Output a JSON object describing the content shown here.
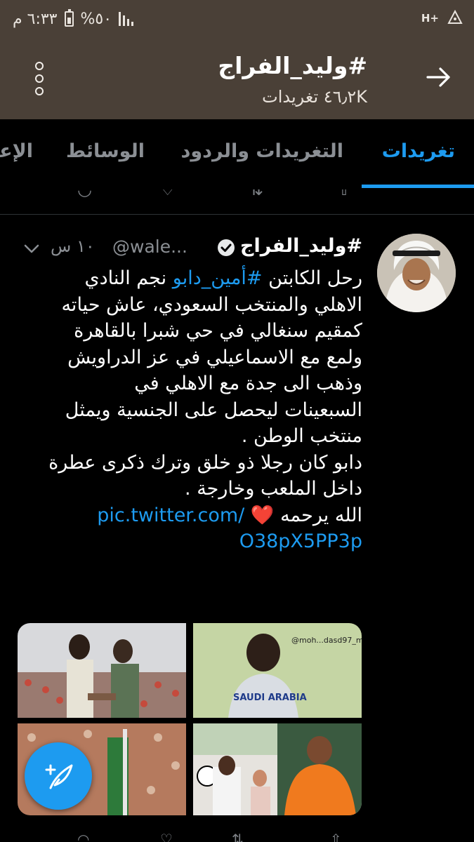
{
  "status_bar": {
    "time": "٦:٣٣ م",
    "battery": "%٥٠",
    "network": "H+"
  },
  "header": {
    "title": "#وليد_الفراج",
    "subtitle": "٤٦٫٢K تغريدات"
  },
  "tabs": [
    {
      "label": "تغريدات",
      "active": true
    },
    {
      "label": "التغريدات والردود",
      "active": false
    },
    {
      "label": "الوسائط",
      "active": false
    },
    {
      "label": "الإعجابات",
      "active": false
    }
  ],
  "tweet": {
    "name": "#وليد_الفراج",
    "handle": "@wale...",
    "time": "١٠ س",
    "body": {
      "l1_a": "رحل الكابتن ",
      "l1_tag": "#أمين_دابو",
      "l1_b": " نجم النادي",
      "l2": "الاهلي والمنتخب السعودي، عاش حياته",
      "l3": "كمقيم سنغالي في حي شبرا بالقاهرة",
      "l4": "ولمع مع الاسماعيلي في عز الدراويش",
      "l5": "وذهب الى جدة مع الاهلي في",
      "l6": "السبعينات ليحصل على الجنسية ويمثل",
      "l7": "منتخب الوطن .",
      "l8": "دابو كان رجلا ذو خلق وترك ذكرى عطرة",
      "l9": "داخل الملعب وخارجة .",
      "l10_a": "الله يرحمه ",
      "l10_heart": "❤️",
      "link_1": "pic.twitter.com/",
      "link_2": "O38pX5PP3p"
    },
    "media_watermark": "@moh...dasd97_m",
    "jersey_text": "SAUDI ARABIA"
  },
  "colors": {
    "header_bg": "#4a4037",
    "accent": "#1d9bf0",
    "background": "#000000"
  }
}
